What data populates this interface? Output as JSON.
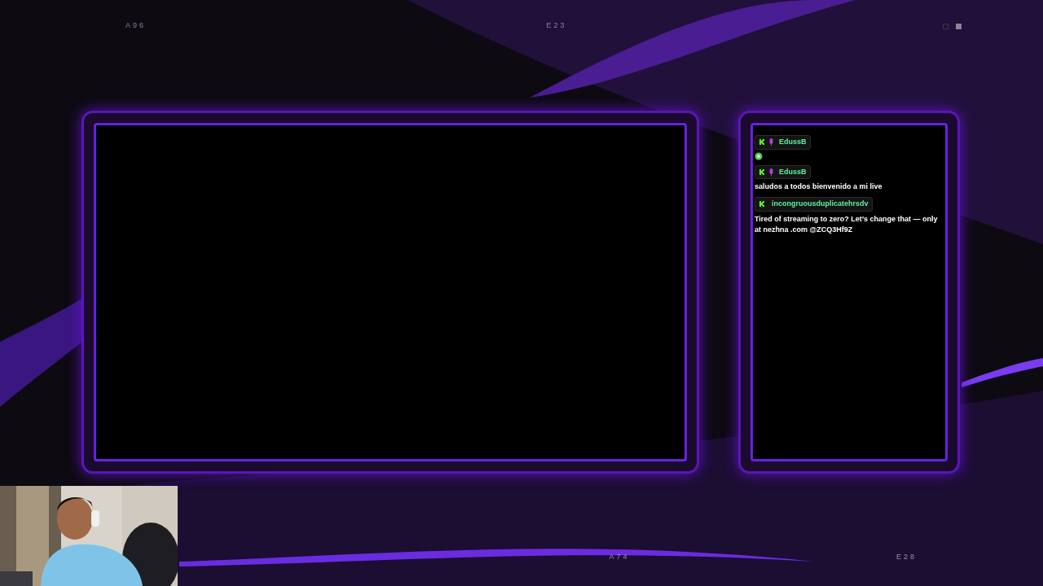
{
  "corner_labels": {
    "top": [
      "A96",
      "E23"
    ],
    "bottom": [
      "A74",
      "E28"
    ]
  },
  "indicators": [
    {
      "on": false
    },
    {
      "on": true
    }
  ],
  "chat": {
    "messages": [
      {
        "user": "EdussB",
        "mic_badge": true,
        "kind": "emote"
      },
      {
        "user": "EdussB",
        "mic_badge": true,
        "kind": "text",
        "text": "saludos a todos bienvenido a mi live"
      },
      {
        "user": "incongruousduplicatehrsdv",
        "mic_badge": false,
        "kind": "text",
        "text": "Tired of streaming to zero? Let’s change that — only at nezhna .com @ZCQ3Hf9Z"
      }
    ]
  }
}
